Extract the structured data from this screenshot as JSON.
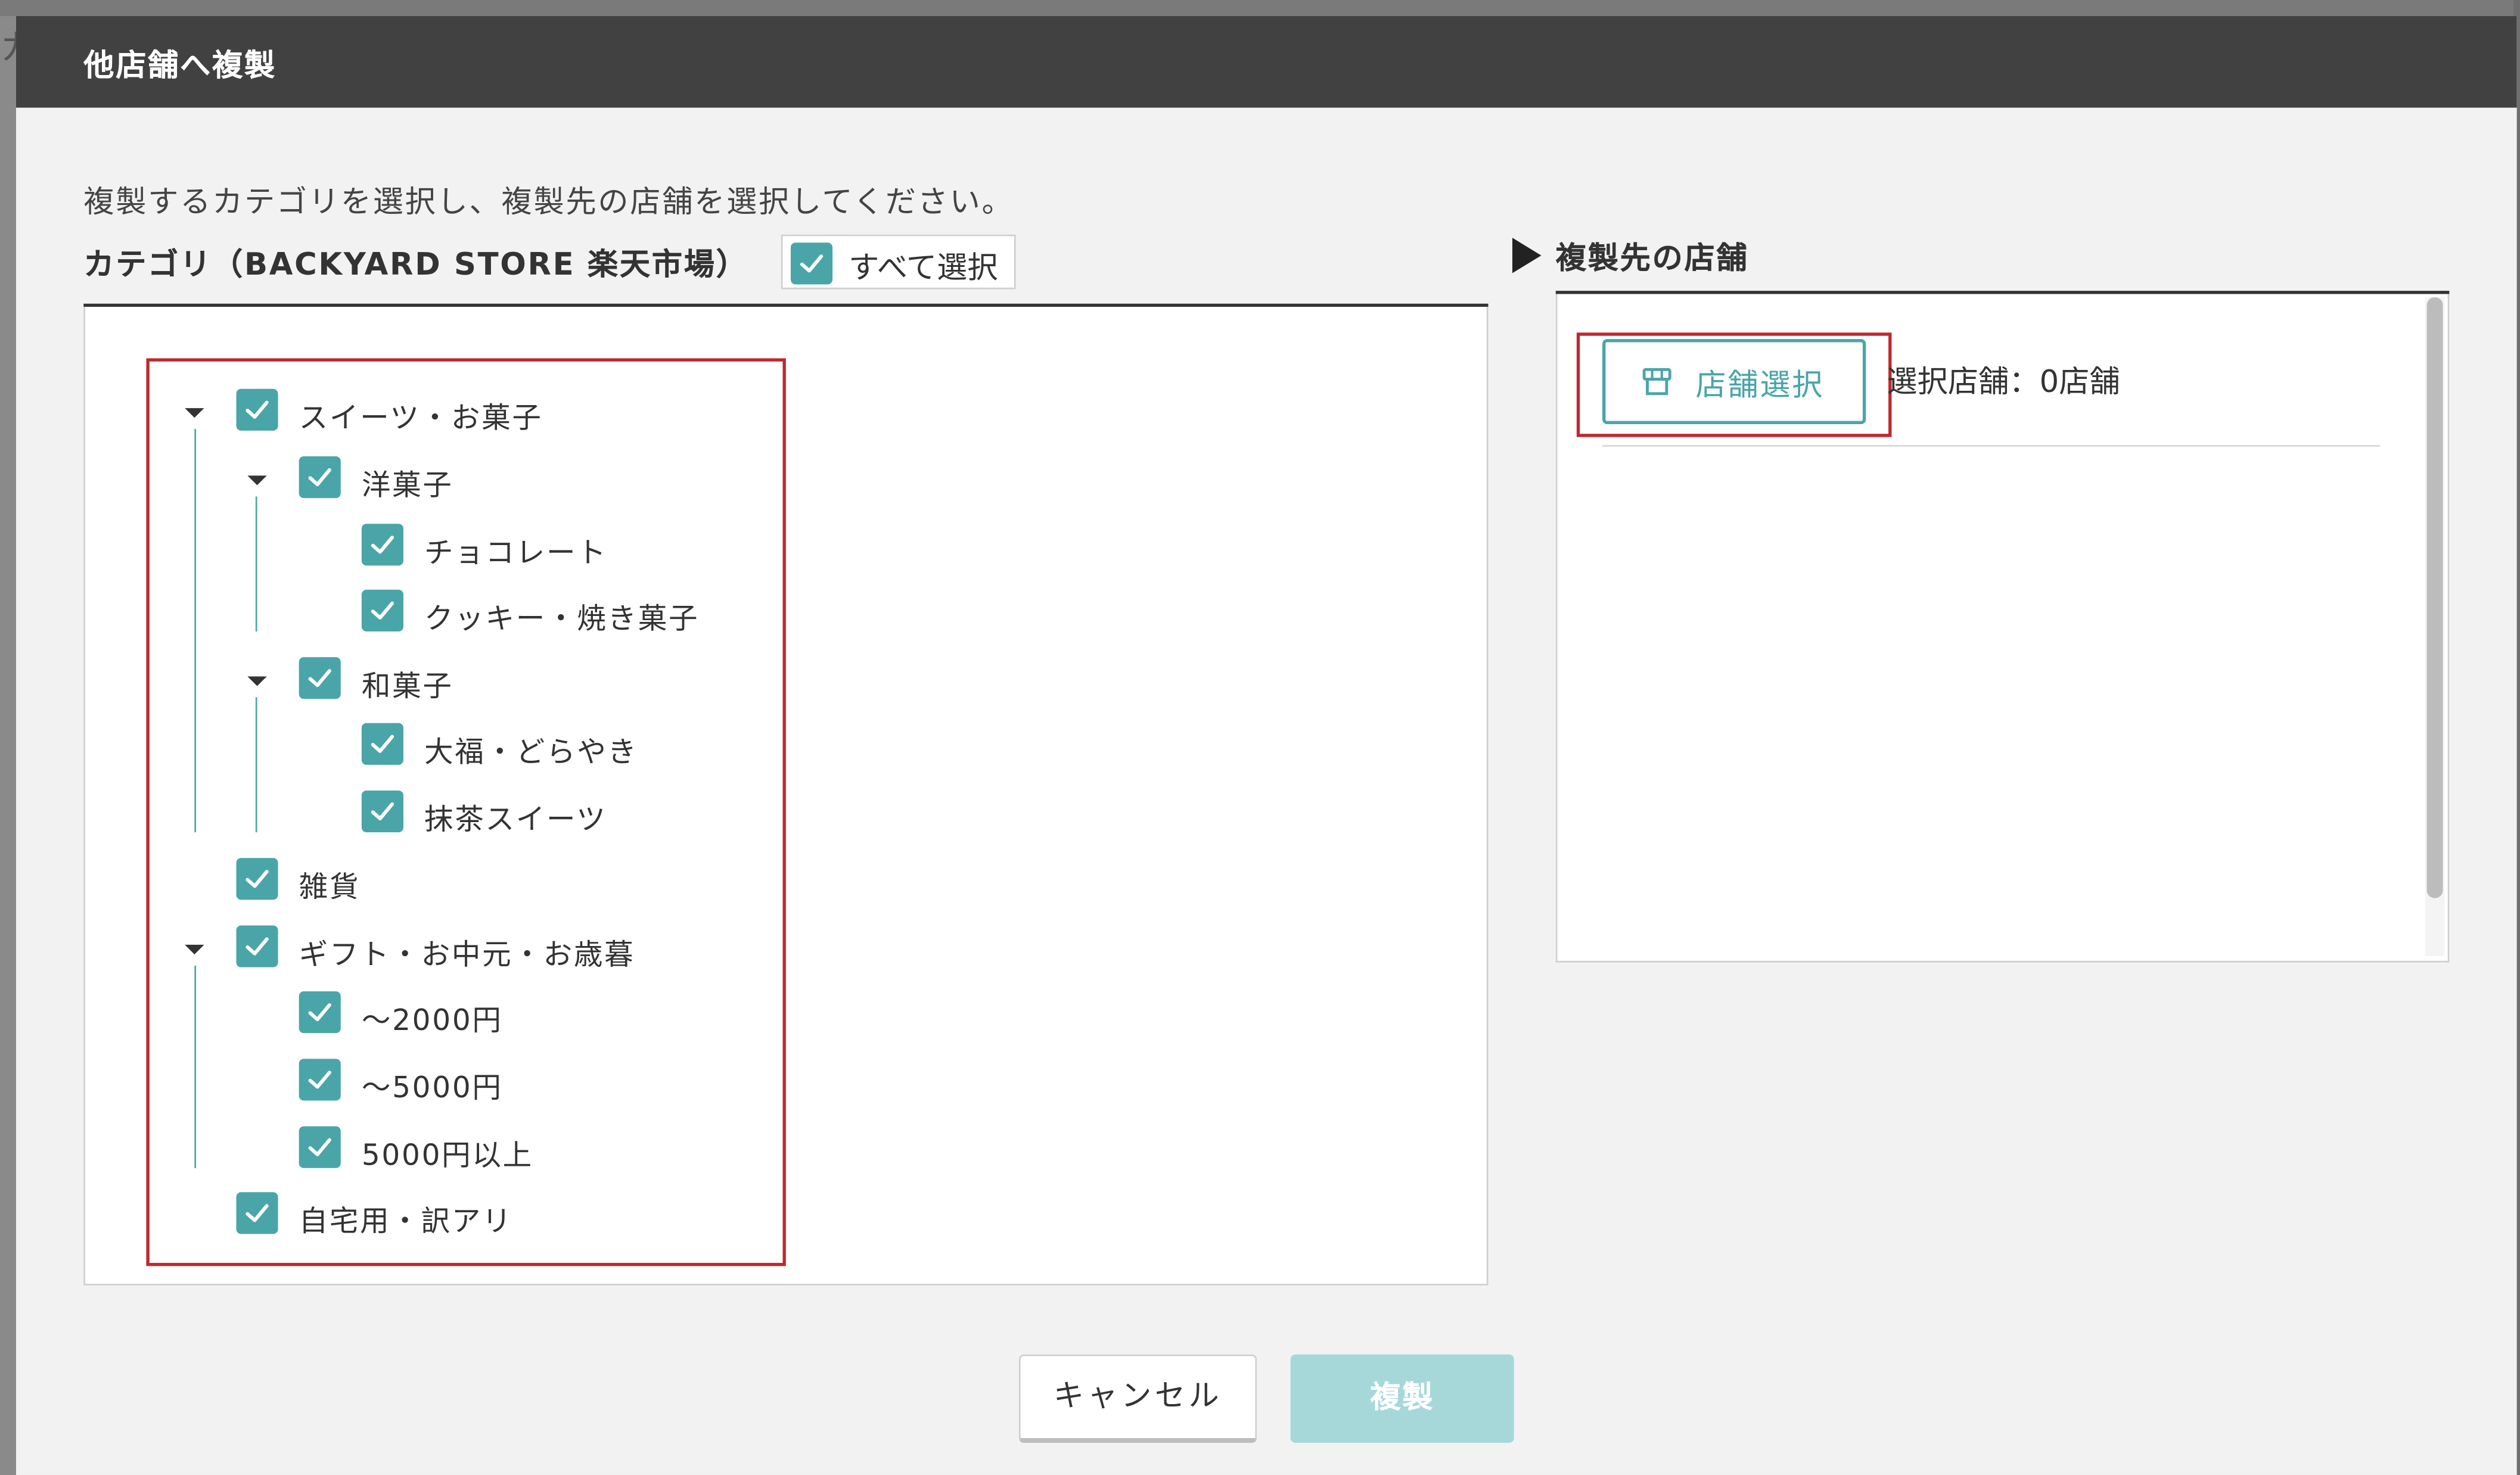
{
  "backdrop": {
    "left_char": "カ"
  },
  "dialog": {
    "title": "他店舗へ複製"
  },
  "instruction": "複製するカテゴリを選択し、複製先の店舗を選択してください。",
  "category_section": {
    "heading": "カテゴリ（BACKYARD STORE 楽天市場）",
    "select_all_label": "すべて選択",
    "select_all_checked": true
  },
  "tree": [
    {
      "label": "スイーツ・お菓子",
      "checked": true,
      "expanded": true
    },
    {
      "label": "洋菓子",
      "checked": true,
      "expanded": true
    },
    {
      "label": "チョコレート",
      "checked": true
    },
    {
      "label": "クッキー・焼き菓子",
      "checked": true
    },
    {
      "label": "和菓子",
      "checked": true,
      "expanded": true
    },
    {
      "label": "大福・どらやき",
      "checked": true
    },
    {
      "label": "抹茶スイーツ",
      "checked": true
    },
    {
      "label": "雑貨",
      "checked": true
    },
    {
      "label": "ギフト・お中元・お歳暮",
      "checked": true,
      "expanded": true
    },
    {
      "label": "～2000円",
      "checked": true
    },
    {
      "label": "～5000円",
      "checked": true
    },
    {
      "label": "5000円以上",
      "checked": true
    },
    {
      "label": "自宅用・訳アリ",
      "checked": true
    }
  ],
  "destination": {
    "heading": "複製先の店舗",
    "store_button_label": "店舗選択",
    "selected_count": "選択店舗：0店舗"
  },
  "footer": {
    "cancel_label": "キャンセル",
    "copy_label": "複製"
  },
  "colors": {
    "accent": "#4aa5a9",
    "header": "#414141",
    "highlight": "#c0282d",
    "copy_disabled": "#a6d8da"
  }
}
